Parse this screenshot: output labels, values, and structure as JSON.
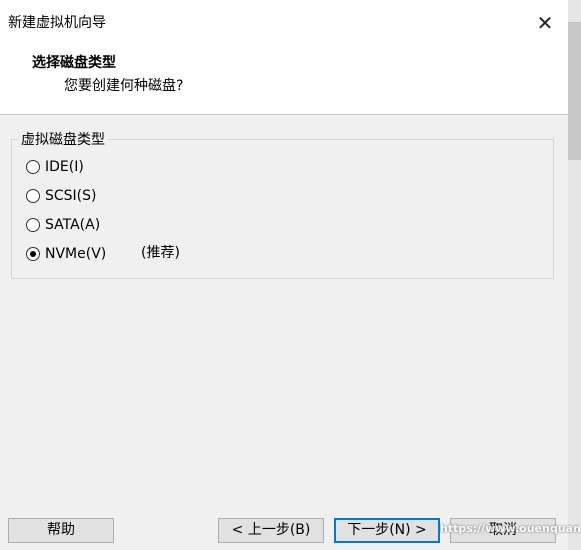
{
  "window": {
    "title": "新建虚拟机向导"
  },
  "header": {
    "title": "选择磁盘类型",
    "subtitle": "您要创建何种磁盘?"
  },
  "disk_type_group": {
    "label": "虚拟磁盘类型",
    "options": [
      {
        "label": "IDE(I)",
        "checked": false
      },
      {
        "label": "SCSI(S)",
        "checked": false
      },
      {
        "label": "SATA(A)",
        "checked": false
      },
      {
        "label": "NVMe(V)",
        "checked": true
      }
    ],
    "recommended_note": "(推荐)"
  },
  "buttons": {
    "help": "帮助",
    "back": "< 上一步(B)",
    "next": "下一步(N) >",
    "cancel": "取消"
  },
  "watermark": "https://www.ouenquanclub.com"
}
